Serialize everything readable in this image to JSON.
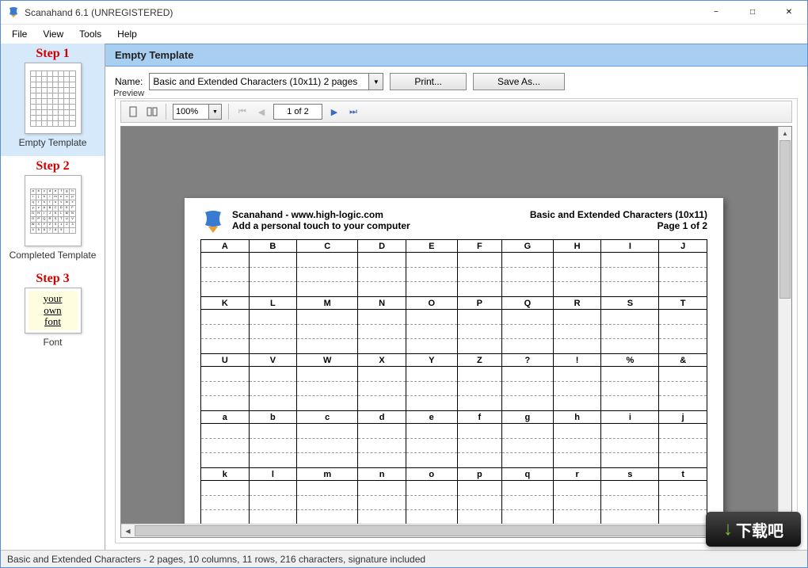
{
  "window": {
    "title": "Scanahand 6.1 (UNREGISTERED)"
  },
  "menu": [
    "File",
    "View",
    "Tools",
    "Help"
  ],
  "sidebar": {
    "steps": [
      {
        "title": "Step 1",
        "label": "Empty Template"
      },
      {
        "title": "Step 2",
        "label": "Completed Template"
      },
      {
        "title": "Step 3",
        "label": "Font",
        "thumb_lines": [
          "your",
          "own",
          "font"
        ]
      }
    ]
  },
  "content": {
    "header": "Empty Template",
    "name_label": "Name:",
    "name_value": "Basic and Extended Characters (10x11) 2 pages",
    "print_label": "Print...",
    "saveas_label": "Save As...",
    "preview_label": "Preview"
  },
  "preview_toolbar": {
    "zoom": "100%",
    "page_text": "1 of 2"
  },
  "page": {
    "brand_line1": "Scanahand - www.high-logic.com",
    "brand_line2": "Add a personal touch to your computer",
    "title_line1": "Basic and Extended Characters (10x11)",
    "title_line2": "Page 1 of 2",
    "rows": [
      [
        "A",
        "B",
        "C",
        "D",
        "E",
        "F",
        "G",
        "H",
        "I",
        "J"
      ],
      [
        "K",
        "L",
        "M",
        "N",
        "O",
        "P",
        "Q",
        "R",
        "S",
        "T"
      ],
      [
        "U",
        "V",
        "W",
        "X",
        "Y",
        "Z",
        "?",
        "!",
        "%",
        "&"
      ],
      [
        "a",
        "b",
        "c",
        "d",
        "e",
        "f",
        "g",
        "h",
        "i",
        "j"
      ],
      [
        "k",
        "l",
        "m",
        "n",
        "o",
        "p",
        "q",
        "r",
        "s",
        "t"
      ]
    ]
  },
  "statusbar": {
    "text": "Basic and Extended Characters - 2 pages, 10 columns, 11 rows, 216 characters, signature included"
  },
  "watermark": "下载吧"
}
